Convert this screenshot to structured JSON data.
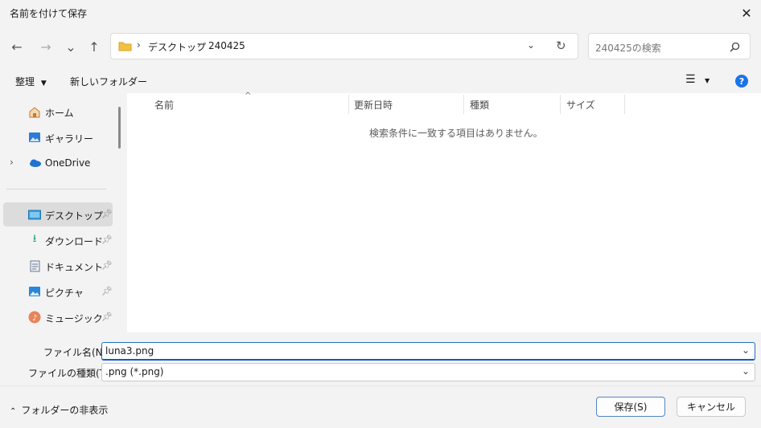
{
  "window": {
    "title": "名前を付けて保存",
    "close_icon": "close-icon"
  },
  "nav": {
    "back_icon": "←",
    "forward_icon": "→",
    "recent_icon": "⌄",
    "up_icon": "↑",
    "breadcrumb": [
      "デスクトップ",
      "240425"
    ],
    "search_placeholder": "240425の検索"
  },
  "toolbar": {
    "organize": "整理",
    "new_folder": "新しいフォルダー",
    "help": "?"
  },
  "sidebar": {
    "items": [
      {
        "label": "ホーム",
        "icon": "home-icon"
      },
      {
        "label": "ギャラリー",
        "icon": "gallery-icon"
      },
      {
        "label": "OneDrive",
        "icon": "cloud-icon"
      },
      {
        "label": "デスクトップ",
        "icon": "desktop-icon",
        "pinned": true
      },
      {
        "label": "ダウンロード",
        "icon": "download-icon",
        "pinned": true
      },
      {
        "label": "ドキュメント",
        "icon": "document-icon",
        "pinned": true
      },
      {
        "label": "ピクチャ",
        "icon": "picture-icon",
        "pinned": true
      },
      {
        "label": "ミュージック",
        "icon": "music-icon",
        "pinned": true
      }
    ]
  },
  "content": {
    "columns": [
      "名前",
      "更新日時",
      "種類",
      "サイズ"
    ],
    "empty_message": "検索条件に一致する項目はありません。"
  },
  "form": {
    "filename_label": "ファイル名(N):",
    "filename_value": "luna3.png",
    "filetype_label": "ファイルの種類(T):",
    "filetype_value": ".png (*.png)"
  },
  "footer": {
    "hide_folders": "フォルダーの非表示",
    "save": "保存(S)",
    "cancel": "キャンセル"
  },
  "colors": {
    "accent": "#0f5cc0",
    "help_blue": "#1a73e8"
  }
}
